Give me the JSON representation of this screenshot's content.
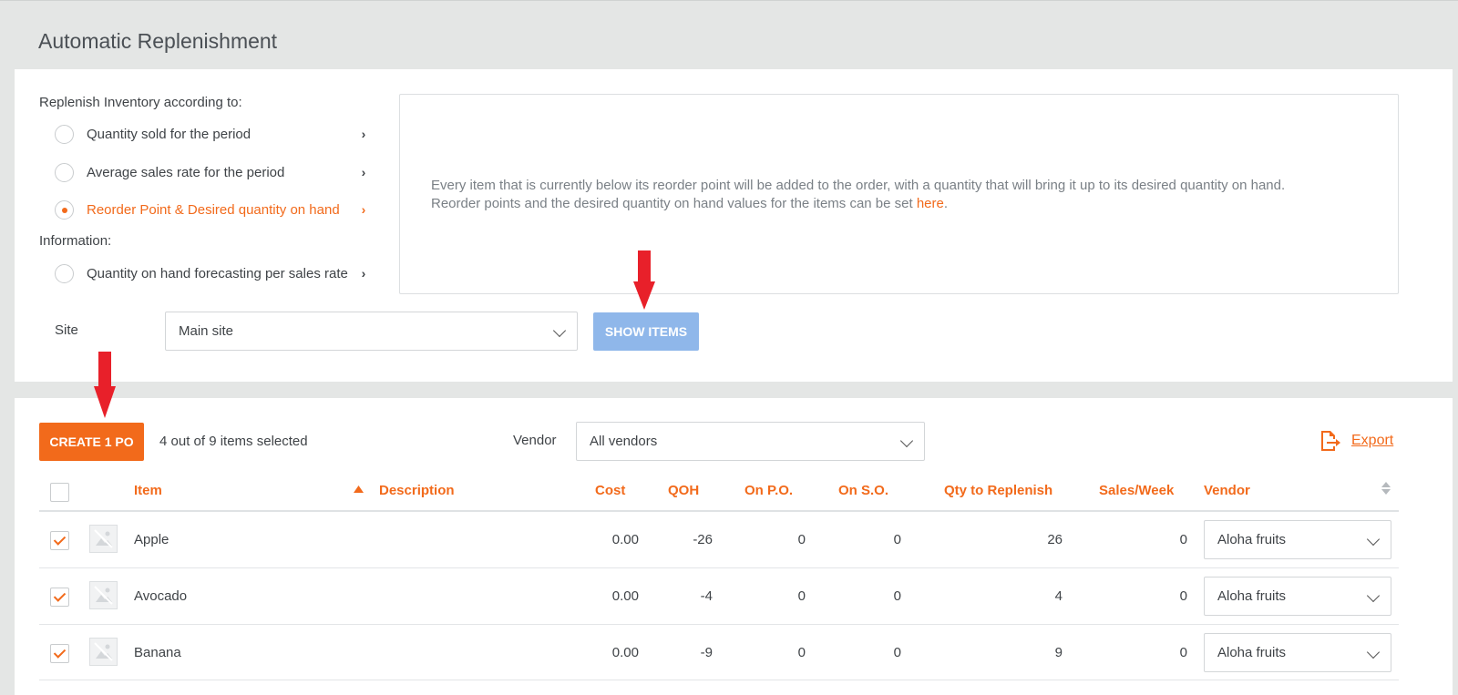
{
  "page": {
    "title": "Automatic Replenishment"
  },
  "replenish": {
    "heading": "Replenish Inventory according to:",
    "options": [
      {
        "label": "Quantity sold for the period",
        "selected": false
      },
      {
        "label": "Average sales rate for the period",
        "selected": false
      },
      {
        "label": "Reorder Point & Desired quantity on hand",
        "selected": true
      }
    ],
    "info_heading": "Information:",
    "info_option": {
      "label": "Quantity on hand forecasting per sales rate",
      "selected": false
    },
    "description_line1": "Every item that is currently below its reorder point will be added to the order, with a quantity that will bring it up to its desired quantity on hand.",
    "description_line2_prefix": "Reorder points and the desired quantity on hand values for the items can be set ",
    "description_link": "here",
    "description_line2_suffix": ".",
    "site_label": "Site",
    "site_value": "Main site",
    "show_items_label": "SHOW ITEMS"
  },
  "orders": {
    "create_label": "CREATE 1 PO",
    "selection_status": "4 out of 9 items selected",
    "vendor_filter_label": "Vendor",
    "vendor_filter_value": "All vendors",
    "export_label": "Export",
    "columns": [
      "Item",
      "Description",
      "Cost",
      "QOH",
      "On P.O.",
      "On S.O.",
      "Qty to Replenish",
      "Sales/Week",
      "Vendor"
    ],
    "rows": [
      {
        "checked": true,
        "item": "Apple",
        "description": "",
        "cost": "0.00",
        "qoh": "-26",
        "on_po": "0",
        "on_so": "0",
        "qty": "26",
        "sales_week": "0",
        "vendor": "Aloha fruits"
      },
      {
        "checked": true,
        "item": "Avocado",
        "description": "",
        "cost": "0.00",
        "qoh": "-4",
        "on_po": "0",
        "on_so": "0",
        "qty": "4",
        "sales_week": "0",
        "vendor": "Aloha fruits"
      },
      {
        "checked": true,
        "item": "Banana",
        "description": "",
        "cost": "0.00",
        "qoh": "-9",
        "on_po": "0",
        "on_so": "0",
        "qty": "9",
        "sales_week": "0",
        "vendor": "Aloha fruits"
      }
    ]
  },
  "colors": {
    "accent": "#f26a1b",
    "button_disabled": "#8fb7ea",
    "annotation_arrow": "#e8202a"
  }
}
